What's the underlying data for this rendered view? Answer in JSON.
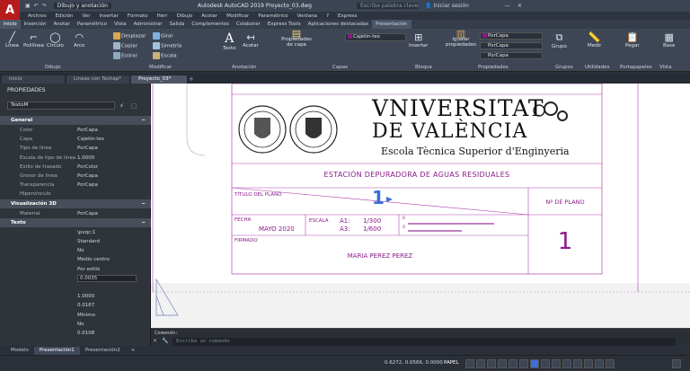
{
  "titlebar": {
    "quick_access_label": "Dibujo y anotación",
    "title": "Autodesk AutoCAD 2019    Proyecto_03.dwg",
    "search_placeholder": "Escriba palabra clave o frase",
    "signin": "Iniciar sesión"
  },
  "logo": "A",
  "menubar": [
    "Archivo",
    "Edición",
    "Ver",
    "Insertar",
    "Formato",
    "Herr",
    "Dibujo",
    "Acotar",
    "Modificar",
    "Paramétrico",
    "Ventana",
    "?",
    "Express"
  ],
  "ribbon_tabs": [
    "Inicio",
    "Inserción",
    "Anotar",
    "Paramétrico",
    "Vista",
    "Administrar",
    "Salida",
    "Complementos",
    "Colaborar",
    "Express Tools",
    "Aplicaciones destacadas",
    "Presentación"
  ],
  "ribbon": {
    "draw": {
      "title": "Dibujo",
      "items": [
        "Línea",
        "Polilínea",
        "Círculo",
        "Arco"
      ]
    },
    "modify": {
      "title": "Modificar",
      "items": [
        "Desplazar",
        "Girar",
        "Copiar",
        "Simetría",
        "Estirar",
        "Escala"
      ]
    },
    "annotation": {
      "title": "Anotación",
      "items": [
        "Texto",
        "Acotar"
      ]
    },
    "layers": {
      "title": "Capas",
      "props_label": "Propiedades de capa",
      "current_layer": "Cajetin-tex"
    },
    "block": {
      "title": "Bloque",
      "insert": "Insertar"
    },
    "properties": {
      "title": "Propiedades",
      "match": "Igualar propiedades",
      "bylayer1": "PorCapa",
      "bylayer2": "PorCapa",
      "bylayer3": "PorCapa"
    },
    "groups": {
      "title": "Grupos",
      "item": "Grupo"
    },
    "utilities": {
      "title": "Utilidades",
      "item": "Medir"
    },
    "clipboard": {
      "title": "Portapapeles",
      "item": "Pegar"
    },
    "view": {
      "title": "Vista",
      "item": "Base"
    }
  },
  "doc_tabs": [
    "Inicio",
    "Lineas con Techap*",
    "Proyecto_03*"
  ],
  "palette": {
    "title": "PROPIEDADES",
    "selector": "TextoM",
    "sections": {
      "general": "General",
      "viz3d": "Visualización 3D",
      "text": "Texto"
    },
    "general_rows": [
      {
        "label": "Color",
        "value": "PorCapa"
      },
      {
        "label": "Capa",
        "value": "Cajetin-tex"
      },
      {
        "label": "Tipo de línea",
        "value": "PorCapa"
      },
      {
        "label": "Escala de tipo de línea",
        "value": "1.0000"
      },
      {
        "label": "Estilo de trazado",
        "value": "PorColor"
      },
      {
        "label": "Grosor de línea",
        "value": "PorCapa"
      },
      {
        "label": "Transparencia",
        "value": "PorCapa"
      },
      {
        "label": "Hipervínculo",
        "value": ""
      }
    ],
    "viz_rows": [
      {
        "label": "Material",
        "value": "PorCapa"
      }
    ],
    "text_values": [
      "\\pxqc;1",
      "Standard",
      "No",
      "Medio centro",
      "Por estilo",
      "0.0035",
      "",
      "1.0000",
      "0.0167",
      "Mínimo",
      "No",
      "0.0108"
    ]
  },
  "drawing": {
    "university_line1": "VNIVERSITAT",
    "university_line2": "DE VALÈNCIA",
    "school": "Escola Tècnica Superior d'Enginyeria",
    "project_title": "ESTACIÓN DEPURADORA DE AGUAS RESIDUALES",
    "plan_title_label": "TÍTULO DEL PLANO",
    "plan_title_value": "1",
    "plan_no_label": "Nº DE PLANO",
    "plan_no_value": "1",
    "date_label": "FECHA",
    "date_value": "MAYO 2020",
    "scale_label": "ESCALA",
    "scale_a1_label": "A1:",
    "scale_a1_value": "1/300",
    "scale_a3_label": "A3:",
    "scale_a3_value": "1/600",
    "signed_label": "FIRMADO",
    "author": "MARIA PEREZ PEREZ",
    "scalebar_zero1": "0",
    "scalebar_zero2": "0"
  },
  "command": {
    "history": "Comando:",
    "placeholder": "Escriba un comando"
  },
  "layout_tabs": [
    "Modelo",
    "Presentación1",
    "Presentación2"
  ],
  "status": {
    "coords": "0.6272, 0.0566, 0.0000",
    "space": "PAPEL"
  },
  "colors": {
    "accent_red": "#b71c1c",
    "drawing_magenta": "#8a1a8a",
    "selection_blue": "#3a6fd8"
  }
}
